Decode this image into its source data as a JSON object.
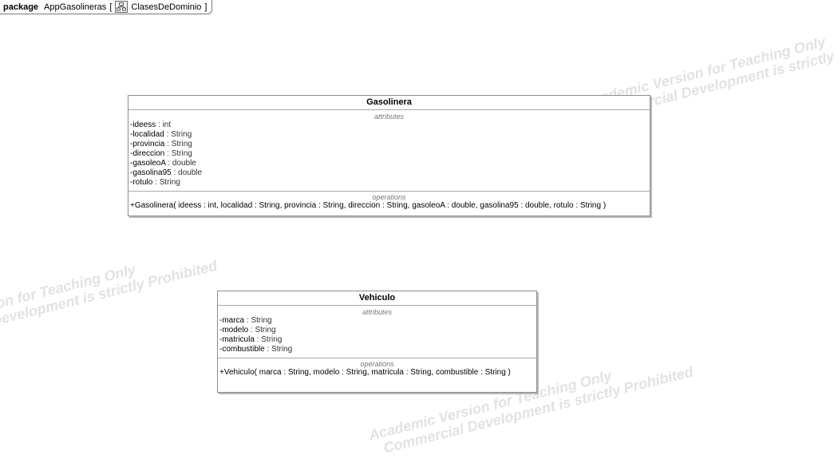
{
  "frame": {
    "keyword": "package",
    "package_name": "AppGasolineras",
    "open_bracket": "[",
    "diagram_name": "ClasesDeDominio",
    "close_bracket": "]",
    "icon": "class-diagram-icon"
  },
  "watermark": {
    "line1": "Academic Version for Teaching Only",
    "line2": "Commercial Development is strictly Prohibited"
  },
  "classes": [
    {
      "name": "Gasolinera",
      "attributes_title": "attributes",
      "attributes": [
        {
          "name": "-ideess",
          "type": " : int"
        },
        {
          "name": "-localidad",
          "type": " : String"
        },
        {
          "name": "-provincia",
          "type": " : String"
        },
        {
          "name": "-direccion",
          "type": " : String"
        },
        {
          "name": "-gasoleoA",
          "type": " : double"
        },
        {
          "name": "-gasolina95",
          "type": " : double"
        },
        {
          "name": "-rotulo",
          "type": " : String"
        }
      ],
      "operations_title": "operations",
      "operations": [
        "+Gasolinera( ideess : int, localidad : String, provincia : String, direccion : String, gasoleoA : double, gasolina95 : double, rotulo : String )"
      ]
    },
    {
      "name": "Vehiculo",
      "attributes_title": "attributes",
      "attributes": [
        {
          "name": "-marca",
          "type": " : String"
        },
        {
          "name": "-modelo",
          "type": " : String"
        },
        {
          "name": "-matricula",
          "type": " : String"
        },
        {
          "name": "-combustible",
          "type": " : String"
        }
      ],
      "operations_title": "operations",
      "operations": [
        "+Vehiculo( marca : String, modelo : String, matricula : String, combustible : String )"
      ]
    }
  ]
}
